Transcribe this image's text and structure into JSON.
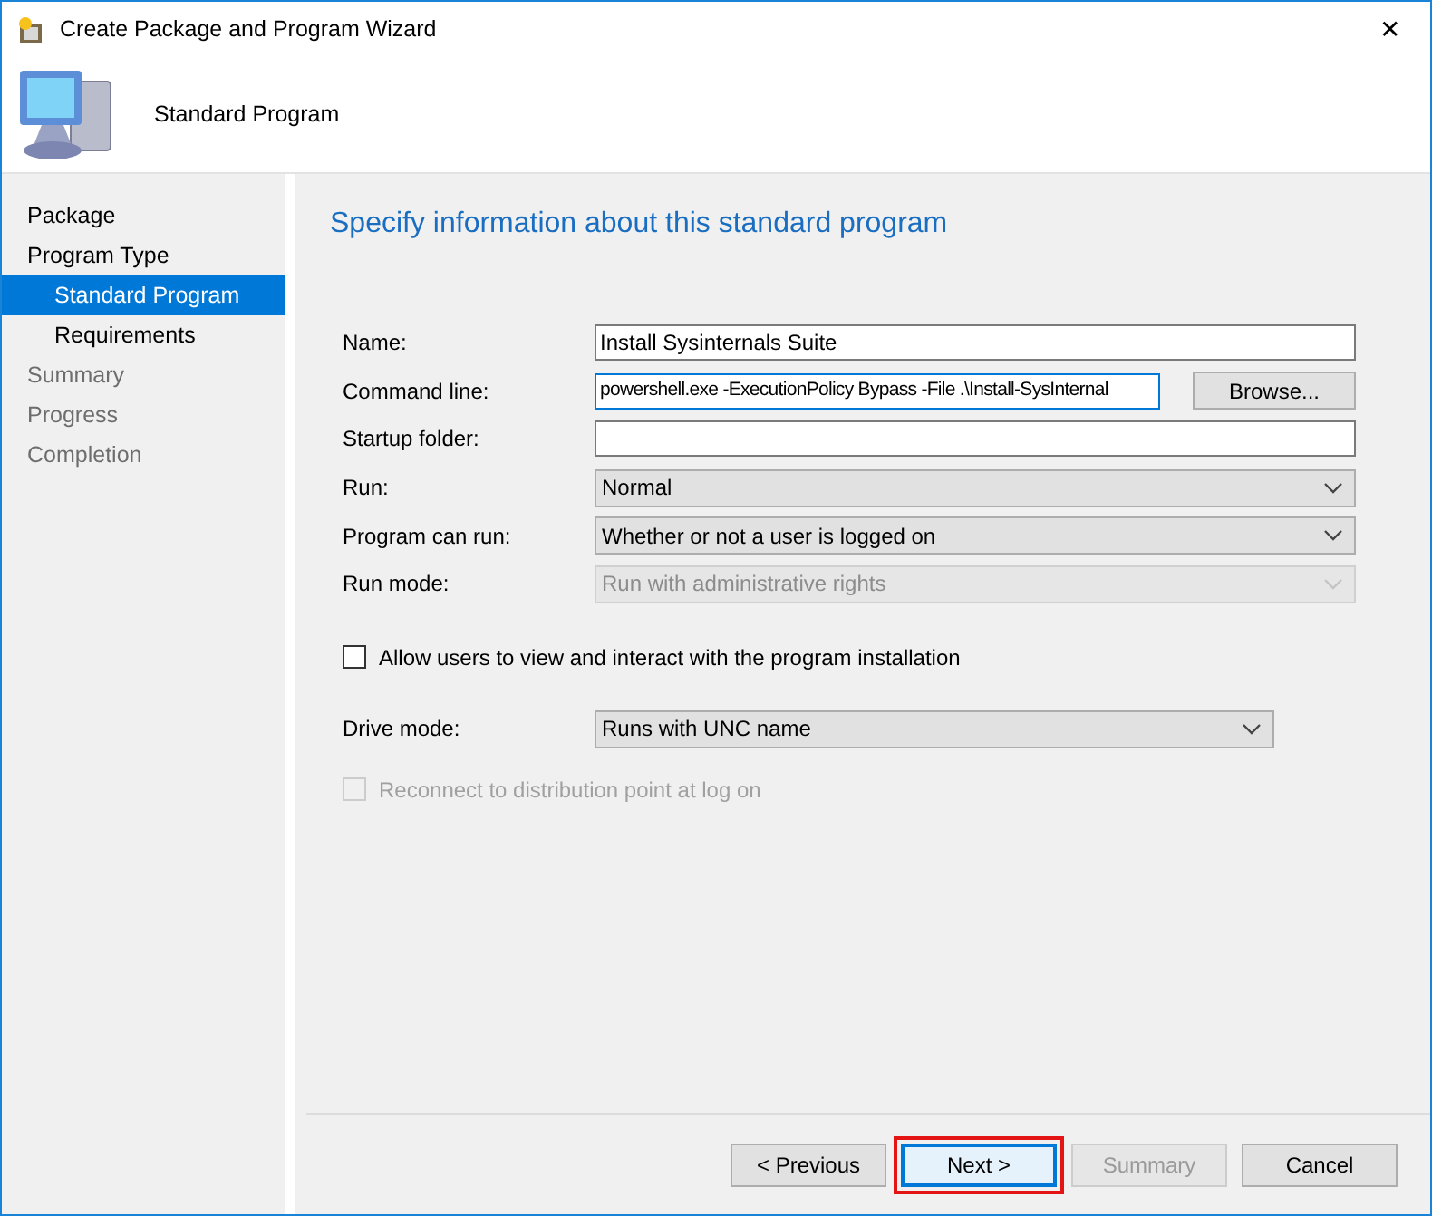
{
  "window": {
    "title": "Create Package and Program Wizard",
    "close": "✕"
  },
  "header": {
    "title": "Standard Program"
  },
  "sidebar": {
    "items": [
      {
        "label": "Package",
        "selected": false,
        "disabled": false
      },
      {
        "label": "Program Type",
        "selected": false,
        "disabled": false,
        "children": [
          {
            "label": "Standard Program",
            "selected": true
          },
          {
            "label": "Requirements",
            "selected": false
          }
        ]
      },
      {
        "label": "Summary",
        "selected": false,
        "disabled": true
      },
      {
        "label": "Progress",
        "selected": false,
        "disabled": true
      },
      {
        "label": "Completion",
        "selected": false,
        "disabled": true
      }
    ]
  },
  "page": {
    "heading": "Specify information about this standard program",
    "fields": [
      {
        "label": "Name:",
        "kind": "text",
        "value": "Install Sysinternals Suite"
      },
      {
        "label": "Command line:",
        "kind": "text",
        "value": "powershell.exe -ExecutionPolicy Bypass -File .\\Install-SysInternal",
        "focused": true,
        "button": "Browse..."
      },
      {
        "label": "Startup folder:",
        "kind": "text"
      },
      {
        "label": "Run:",
        "kind": "combo",
        "value": "Normal",
        "disabled": false
      },
      {
        "label": "Program can run:",
        "kind": "combo",
        "value": "Whether or not a user is logged on",
        "disabled": false
      },
      {
        "label": "Run mode:",
        "kind": "combo",
        "value": "Run with administrative rights",
        "disabled": true
      }
    ],
    "allow_interact": {
      "label": "Allow users to view and interact with the program installation",
      "checked": false,
      "disabled": false
    },
    "drive_mode": {
      "label": "Drive mode:",
      "value": "Runs with UNC name"
    },
    "reconnect": {
      "label": "Reconnect to distribution point at log on",
      "checked": false,
      "disabled": true
    }
  },
  "buttons": [
    {
      "label": "< Previous",
      "disabled": false
    },
    {
      "label": "Next >",
      "disabled": false,
      "highlighted": true
    },
    {
      "label": "Summary",
      "disabled": true
    },
    {
      "label": "Cancel",
      "disabled": false
    }
  ]
}
